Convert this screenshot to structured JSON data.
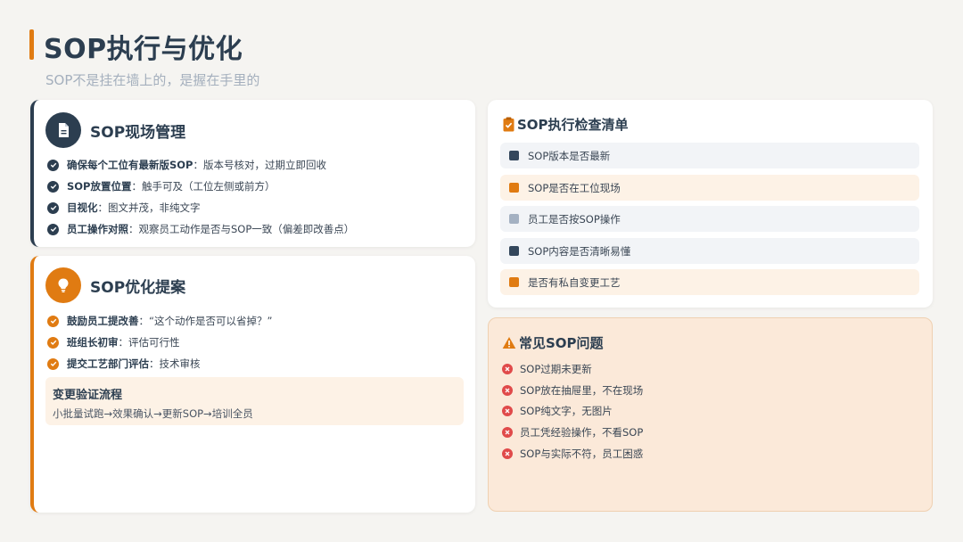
{
  "header": {
    "title": "SOP执行与优化",
    "subtitle": "SOP不是挂在墙上的，是握在手里的"
  },
  "colors": {
    "accent": "#e07b12",
    "dark": "#2c3e50",
    "muted": "#a4afbd",
    "danger": "#e04a4a"
  },
  "site_card": {
    "icon": "document-icon",
    "title": "SOP现场管理",
    "items": [
      {
        "bold": "确保每个工位有最新版SOP",
        "text": "：版本号核对，过期立即回收"
      },
      {
        "bold": "SOP放置位置",
        "text": "：触手可及（工位左侧或前方）"
      },
      {
        "bold": "目视化",
        "text": "：图文并茂，非纯文字"
      },
      {
        "bold": "员工操作对照",
        "text": "：观察员工动作是否与SOP一致（偏差即改善点）"
      }
    ]
  },
  "proposal_card": {
    "icon": "lightbulb-icon",
    "title": "SOP优化提案",
    "items": [
      {
        "bold": "鼓励员工提改善",
        "text": "：“这个动作是否可以省掉？”"
      },
      {
        "bold": "班组长初审",
        "text": "：评估可行性"
      },
      {
        "bold": "提交工艺部门评估",
        "text": "：技术审核"
      }
    ],
    "flow": {
      "title": "变更验证流程",
      "desc": "小批量试跑→效果确认→更新SOP→培训全员"
    }
  },
  "checklist": {
    "icon": "clipboard-check-icon",
    "title": "SOP执行检查清单",
    "items": [
      {
        "text": "SOP版本是否最新",
        "marker": "#34475c",
        "bg": "gray"
      },
      {
        "text": "SOP是否在工位现场",
        "marker": "#e07b12",
        "bg": "peach"
      },
      {
        "text": "员工是否按SOP操作",
        "marker": "#a4b1c2",
        "bg": "gray"
      },
      {
        "text": "SOP内容是否清晰易懂",
        "marker": "#34475c",
        "bg": "gray"
      },
      {
        "text": "是否有私自变更工艺",
        "marker": "#e07b12",
        "bg": "peach"
      }
    ]
  },
  "problems": {
    "icon": "warning-icon",
    "title": "常见SOP问题",
    "items": [
      "SOP过期未更新",
      "SOP放在抽屉里，不在现场",
      "SOP纯文字，无图片",
      "员工凭经验操作，不看SOP",
      "SOP与实际不符，员工困惑"
    ]
  }
}
